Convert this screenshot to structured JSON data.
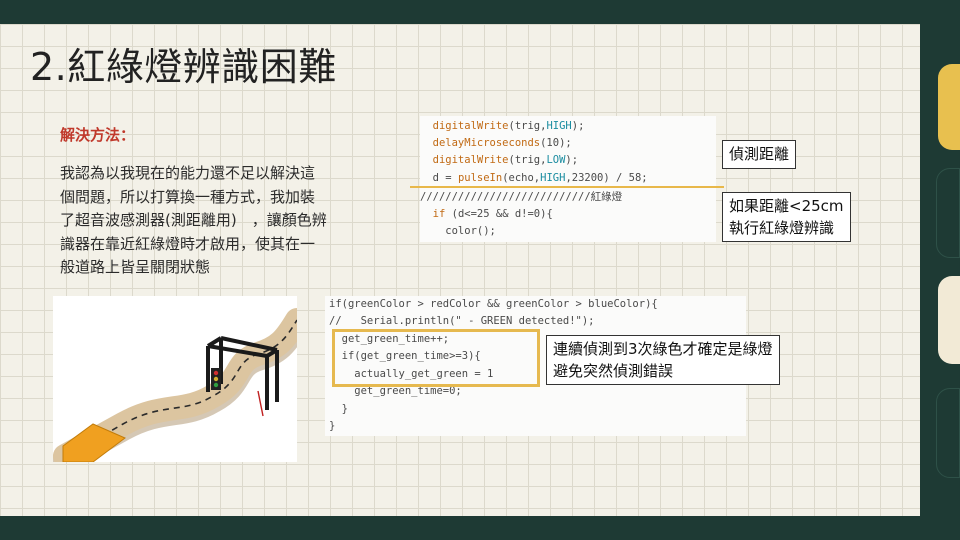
{
  "title": "2.紅綠燈辨識困難",
  "method": {
    "heading": "解決方法：",
    "lines": [
      "我認為以我現在的能力還不足以解決這",
      "個問題，所以打算換一種方式，我加裝",
      "了超音波感測器(測距離用)　，讓顏色辨",
      "識器在靠近紅綠燈時才啟用，使其在一",
      "般道路上皆呈關閉狀態"
    ]
  },
  "code1": {
    "lines": [
      "  digitalWrite(trig,HIGH);",
      "  delayMicroseconds(10);",
      "  digitalWrite(trig,LOW);",
      "  d = pulseIn(echo,HIGH,23200) / 58;",
      "///////////////////////////紅綠燈",
      "  if (d<=25 && d!=0){",
      "    color();"
    ]
  },
  "code2": {
    "lines": [
      "if(greenColor > redColor && greenColor > blueColor){",
      "//   Serial.println(\" - GREEN detected!\");",
      "  get_green_time++;",
      "  if(get_green_time>=3){",
      "    actually_get_green = 1",
      "    get_green_time=0;",
      "  }",
      "}"
    ]
  },
  "callouts": {
    "distance": "偵測距離",
    "cond_line1": "如果距離<25cm",
    "cond_line2": "執行紅綠燈辨識",
    "green_line1": "連續偵測到3次綠色才確定是綠燈",
    "green_line2": "避免突然偵測錯誤"
  },
  "colors": {
    "background": "#1e3a34",
    "slide": "#f3f1e8",
    "accent_red": "#c0392b",
    "highlight": "#e8b84a",
    "tab_yellow": "#e8c04f",
    "tab_cream": "#f2ead6",
    "tab_dark": "#1e3a34"
  },
  "photo": {
    "subject": "track-with-traffic-light-gate"
  }
}
